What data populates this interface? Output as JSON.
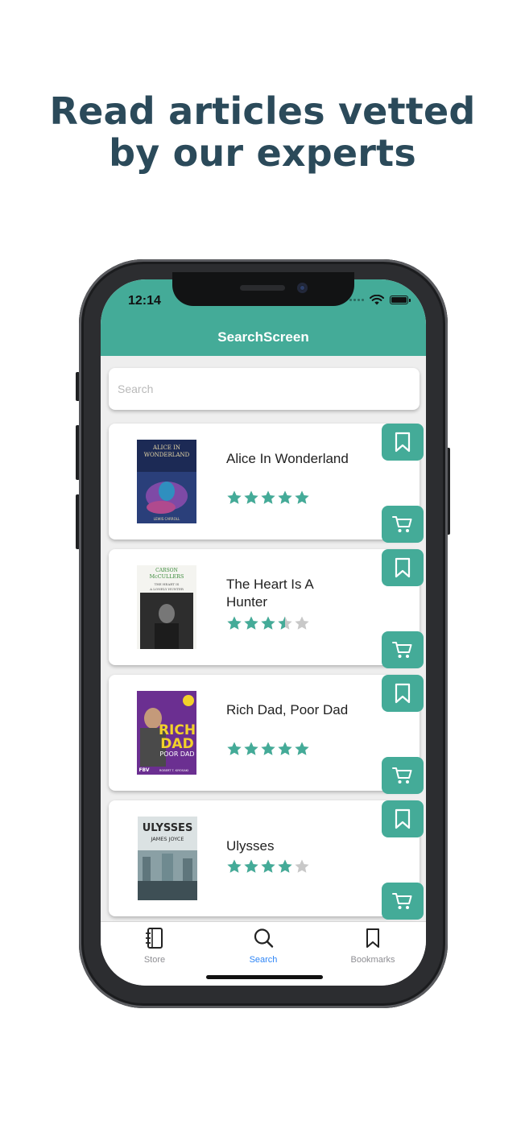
{
  "headline": {
    "line1": "Read articles vetted",
    "line2": "by our experts"
  },
  "status_bar": {
    "time": "12:14"
  },
  "app_bar": {
    "title": "SearchScreen"
  },
  "search": {
    "placeholder": "Search",
    "value": ""
  },
  "books": [
    {
      "title": "Alice In Wonderland",
      "rating": 5,
      "cover": {
        "label": "ALICE IN WONDERLAND",
        "colors": [
          "#1c2a55",
          "#7e4aa6",
          "#2f8fbf"
        ]
      }
    },
    {
      "title": "The Heart Is A Hunter",
      "rating": 3.5,
      "cover": {
        "label": "CARSON McCULLERS",
        "colors": [
          "#f4f4f0",
          "#3a3a3a",
          "#1c1c1c"
        ]
      }
    },
    {
      "title": "Rich Dad, Poor Dad",
      "rating": 5,
      "cover": {
        "label": "RICH DAD POOR DAD",
        "colors": [
          "#6b2f91",
          "#f2d12a",
          "#4a1e66"
        ]
      }
    },
    {
      "title": "Ulysses",
      "rating": 4,
      "cover": {
        "label": "ULYSSES JAMES JOYCE",
        "colors": [
          "#dbe2e3",
          "#6f8a90",
          "#3e4f55"
        ]
      }
    }
  ],
  "cover_text": {
    "b0": {
      "l1": "ALICE IN",
      "l2": "WONDERLAND",
      "l3": "LEWIS CARROLL"
    },
    "b1": {
      "l1": "CARSON",
      "l2": "McCULLERS",
      "l3": "THE HEART IS",
      "l4": "A LONELY HUNTER"
    },
    "b2": {
      "l1": "RICH",
      "l2": "DAD",
      "l3": "POOR DAD",
      "l4": "ROBERT T. KIYOSAKI",
      "l5": "FBV"
    },
    "b3": {
      "l1": "ULYSSES",
      "l2": "JAMES JOYCE"
    }
  },
  "tabs": [
    {
      "label": "Store",
      "icon": "notebook-icon",
      "active": false
    },
    {
      "label": "Search",
      "icon": "search-icon",
      "active": true
    },
    {
      "label": "Bookmarks",
      "icon": "bookmark-icon",
      "active": false
    }
  ],
  "colors": {
    "accent": "#44ab98",
    "headline": "#2b4a5a",
    "active_tab": "#2f86f6",
    "star_empty": "#c8c8c8"
  }
}
